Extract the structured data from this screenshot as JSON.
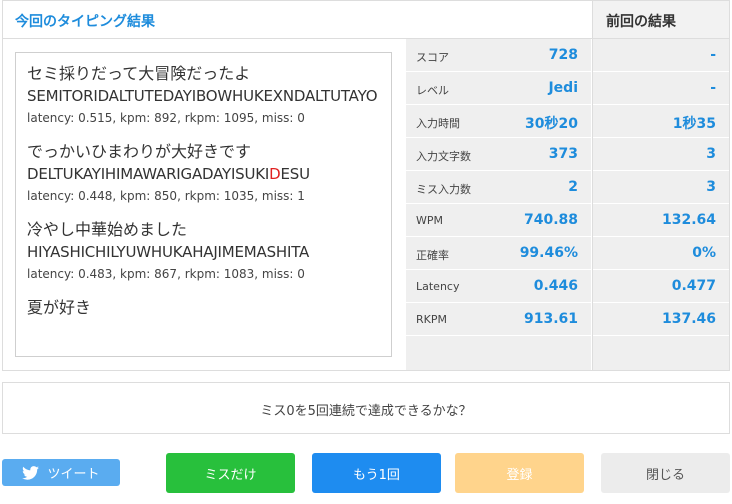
{
  "current": {
    "title": "今回のタイピング結果",
    "log": [
      {
        "jp": "セミ採りだって大冒険だったよ",
        "roma": "SEMITORIDALTUTEDAYIBOWHUKEXNDALTUTAYO",
        "stats": "latency: 0.515, kpm: 892, rkpm: 1095, miss: 0"
      },
      {
        "jp": "でっかいひまわりが大好きです",
        "roma_before": "DELTUKAYIHIMAWARIGADAYISUKI",
        "roma_miss": "D",
        "roma_after": "ESU",
        "stats": "latency: 0.448, kpm: 850, rkpm: 1035, miss: 1"
      },
      {
        "jp": "冷やし中華始めました",
        "roma": "HIYASHICHILYUWHUKAHAJIMEMASHITA",
        "stats": "latency: 0.483, kpm: 867, rkpm: 1083, miss: 0"
      },
      {
        "jp": "夏が好き"
      }
    ],
    "rows": [
      {
        "label": "スコア",
        "value": "728"
      },
      {
        "label": "レベル",
        "value": "Jedi"
      },
      {
        "label": "入力時間",
        "value": "30秒20"
      },
      {
        "label": "入力文字数",
        "value": "373"
      },
      {
        "label": "ミス入力数",
        "value": "2"
      },
      {
        "label": "WPM",
        "value": "740.88"
      },
      {
        "label": "正確率",
        "value": "99.46%"
      },
      {
        "label": "Latency",
        "value": "0.446"
      },
      {
        "label": "RKPM",
        "value": "913.61"
      }
    ]
  },
  "previous": {
    "title": "前回の結果",
    "values": [
      "-",
      "-",
      "1秒35",
      "3",
      "3",
      "132.64",
      "0%",
      "0.477",
      "137.46"
    ]
  },
  "challenge": "ミス0を5回連続で達成できるかな？",
  "buttons": {
    "tweet": "ツイート",
    "miss_only": "ミスだけ",
    "retry": "もう1回",
    "register": "登録",
    "close": "閉じる"
  },
  "colors": {
    "accent": "#1e8cdc",
    "miss_text": "#e02020",
    "tweet": "#5aacf0",
    "miss_only": "#28c03c",
    "retry": "#1e8cf0",
    "register": "#ffd48c",
    "close": "#ececec"
  },
  "icons": {
    "tweet": "twitter-bird-icon"
  }
}
